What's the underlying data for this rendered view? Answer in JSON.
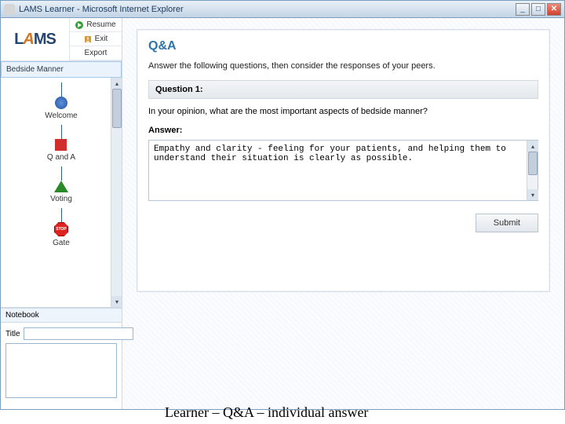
{
  "window": {
    "title": "LAMS Learner - Microsoft Internet Explorer"
  },
  "logo": {
    "part1": "L",
    "part2": "A",
    "part3": "MS"
  },
  "topActions": {
    "resume": "Resume",
    "exit": "Exit",
    "export": "Export"
  },
  "sequence": {
    "title": "Bedside Manner",
    "nodes": [
      {
        "label": "Welcome"
      },
      {
        "label": "Q and A"
      },
      {
        "label": "Voting"
      },
      {
        "label": "Gate",
        "stop": "STOP"
      }
    ]
  },
  "notebook": {
    "header": "Notebook",
    "titleLabel": "Title",
    "titleValue": ""
  },
  "qa": {
    "heading": "Q&A",
    "instructions": "Answer the following questions, then consider the responses of your peers.",
    "question_label": "Question 1:",
    "question_text": "In your opinion, what are the most important aspects of bedside manner?",
    "answer_label": "Answer:",
    "answer_value": "Empathy and clarity - feeling for your patients, and helping them to understand their situation is clearly as possible.",
    "submit": "Submit"
  },
  "caption": "Learner – Q&A – individual answer"
}
